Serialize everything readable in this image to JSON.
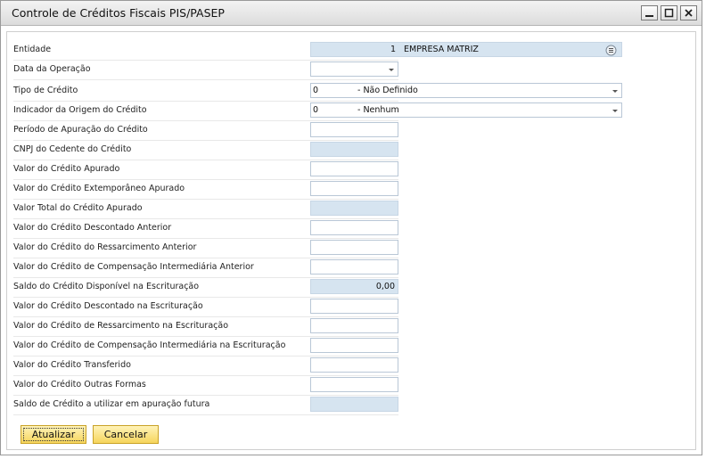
{
  "window": {
    "title": "Controle de Créditos Fiscais PIS/PASEP"
  },
  "fields": [
    {
      "label": "Entidade",
      "value_code": "1",
      "value_text": "EMPRESA MATRIZ"
    },
    {
      "label": "Data da Operação",
      "value": ""
    },
    {
      "label": "Tipo de Crédito",
      "value_code": "0",
      "value_text": "- Não Definido"
    },
    {
      "label": "Indicador da Origem do Crédito",
      "value_code": "0",
      "value_text": "- Nenhum"
    },
    {
      "label": "Período de Apuração do Crédito",
      "value": ""
    },
    {
      "label": "CNPJ do Cedente do Crédito",
      "value": ""
    },
    {
      "label": "Valor do Crédito Apurado",
      "value": ""
    },
    {
      "label": "Valor do Crédito Extemporâneo Apurado",
      "value": ""
    },
    {
      "label": "Valor Total do Crédito Apurado",
      "value": ""
    },
    {
      "label": "Valor do Crédito Descontado Anterior",
      "value": ""
    },
    {
      "label": "Valor do Crédito do Ressarcimento Anterior",
      "value": ""
    },
    {
      "label": "Valor do Crédito de Compensação Intermediária Anterior",
      "value": ""
    },
    {
      "label": "Saldo do Crédito Disponível na Escrituração",
      "value": "0,00"
    },
    {
      "label": "Valor do Crédito Descontado na Escrituração",
      "value": ""
    },
    {
      "label": "Valor do Crédito de Ressarcimento na Escrituração",
      "value": ""
    },
    {
      "label": "Valor do Crédito de Compensação Intermediária na Escrituração",
      "value": ""
    },
    {
      "label": "Valor do Crédito Transferido",
      "value": ""
    },
    {
      "label": "Valor do Crédito Outras Formas",
      "value": ""
    },
    {
      "label": "Saldo de Crédito a utilizar em apuração futura",
      "value": ""
    }
  ],
  "buttons": {
    "update_label": "Atualizar",
    "cancel_label": "Cancelar"
  },
  "icons": {
    "minimize": "minimize-icon",
    "maximize": "maximize-icon",
    "close": "close-icon",
    "list": "list-icon",
    "dropdown": "chevron-down-icon"
  },
  "colors": {
    "readonly_field": "#d6e4f0",
    "button_fill": "#f6d55c",
    "button_border": "#c9a227"
  }
}
